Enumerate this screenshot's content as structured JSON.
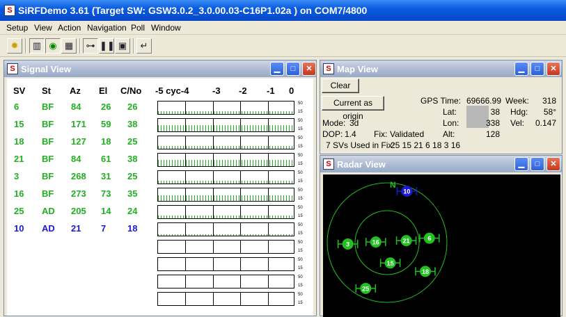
{
  "app": {
    "title": "SiRFDemo 3.61 (Target SW: GSW3.0.2_3.0.00.03-C16P1.02a ) on COM7/4800"
  },
  "menu": [
    "Setup",
    "View",
    "Action",
    "Navigation",
    "Poll",
    "Window"
  ],
  "toolbar": [
    "sun-icon",
    "signal-chart-icon",
    "radar-icon",
    "grid-icon",
    "connect-icon",
    "pause-icon",
    "save-icon",
    "return-icon"
  ],
  "signal_view": {
    "title": "Signal View",
    "headers": [
      "SV",
      "St",
      "Az",
      "El",
      "C/No"
    ],
    "scale_labels": [
      "-5 cyc-4",
      "-3",
      "-2",
      "-1",
      "0"
    ],
    "axis_top": "50",
    "axis_bottom": "15",
    "rows": [
      {
        "sv": "6",
        "st": "BF",
        "az": "84",
        "el": "26",
        "cno": "26",
        "color": "#22b022",
        "level": 0.3
      },
      {
        "sv": "15",
        "st": "BF",
        "az": "171",
        "el": "59",
        "cno": "38",
        "color": "#22b022",
        "level": 0.65
      },
      {
        "sv": "18",
        "st": "BF",
        "az": "127",
        "el": "18",
        "cno": "25",
        "color": "#22b022",
        "level": 0.28
      },
      {
        "sv": "21",
        "st": "BF",
        "az": "84",
        "el": "61",
        "cno": "38",
        "color": "#22b022",
        "level": 0.65
      },
      {
        "sv": "3",
        "st": "BF",
        "az": "268",
        "el": "31",
        "cno": "25",
        "color": "#22b022",
        "level": 0.28
      },
      {
        "sv": "16",
        "st": "BF",
        "az": "273",
        "el": "73",
        "cno": "35",
        "color": "#22b022",
        "level": 0.55
      },
      {
        "sv": "25",
        "st": "AD",
        "az": "205",
        "el": "14",
        "cno": "24",
        "color": "#22b022",
        "level": 0.25
      },
      {
        "sv": "10",
        "st": "AD",
        "az": "21",
        "el": "7",
        "cno": "18",
        "color": "#1a1ad2",
        "level": 0.08
      }
    ],
    "empty_bars": 4
  },
  "map_view": {
    "title": "Map View",
    "clear": "Clear",
    "origin": "Current as origin",
    "gps_time_label": "GPS Time:",
    "gps_time": "69666.99",
    "week_label": "Week:",
    "week": "318",
    "lat_label": "Lat:",
    "lat": "38",
    "hdg_label": "Hdg:",
    "hdg": "58°",
    "lon_label": "Lon:",
    "lon": "338",
    "vel_label": "Vel:",
    "vel": "0.147",
    "mode_label": "Mode:",
    "mode": "3d",
    "alt_label": "Alt:",
    "alt": "128",
    "dop_label": "DOP:",
    "dop": "1.4",
    "fix_label": "Fix:",
    "fix": "Validated",
    "svs_used_label": "7 SVs Used in Fix:",
    "svs_used": "25 15 21 6 18 3 16"
  },
  "radar_view": {
    "title": "Radar View",
    "north": "N",
    "satellites": [
      {
        "id": "10",
        "az": 21,
        "el": 7,
        "color": "#1a1ad2"
      },
      {
        "id": "6",
        "az": 84,
        "el": 26,
        "color": "#22c022"
      },
      {
        "id": "21",
        "az": 84,
        "el": 61,
        "color": "#22c022"
      },
      {
        "id": "16",
        "az": 273,
        "el": 73,
        "color": "#22c022"
      },
      {
        "id": "3",
        "az": 268,
        "el": 31,
        "color": "#22c022"
      },
      {
        "id": "15",
        "az": 171,
        "el": 59,
        "color": "#22c022"
      },
      {
        "id": "18",
        "az": 127,
        "el": 18,
        "color": "#22c022"
      },
      {
        "id": "25",
        "az": 205,
        "el": 14,
        "color": "#22c022"
      }
    ]
  }
}
